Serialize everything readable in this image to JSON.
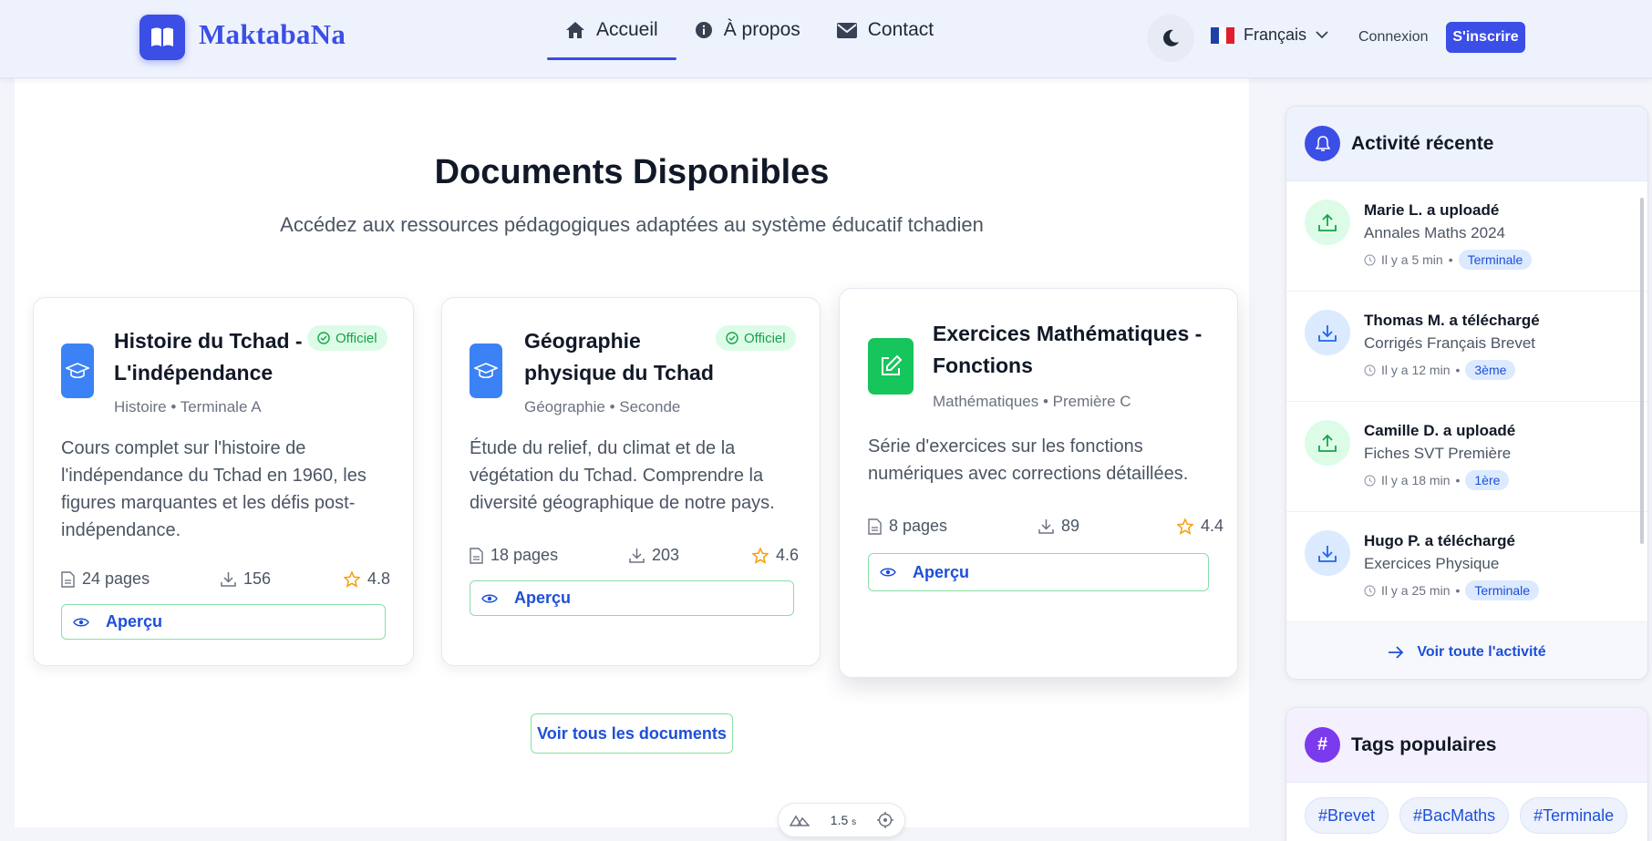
{
  "brand": {
    "name": "MaktabaNa",
    "color": "#3b4ee6"
  },
  "nav": [
    {
      "label": "Accueil",
      "icon": "home-icon",
      "active": true
    },
    {
      "label": "À propos",
      "icon": "info-icon",
      "active": false
    },
    {
      "label": "Contact",
      "icon": "mail-icon",
      "active": false
    }
  ],
  "header": {
    "language": "Français",
    "login": "Connexion",
    "signup": "S'inscrire"
  },
  "section": {
    "title": "Documents Disponibles",
    "subtitle": "Accédez aux ressources pédagogiques adaptées au système éducatif tchadien"
  },
  "documents": [
    {
      "title_line1": "Histoire du Tchad -",
      "title_line2": "L'indépendance",
      "meta": "Histoire • Terminale A",
      "badge": "Officiel",
      "desc": [
        "Cours complet sur l'histoire de",
        "l'indépendance du Tchad en 1960, les",
        "figures marquantes et les défis post-",
        "indépendance."
      ],
      "pages": "24 pages",
      "downloads": "156",
      "rating": "4.8",
      "preview": "Aperçu",
      "icon": "graduation-cap-icon"
    },
    {
      "title_line1": "Géographie",
      "title_line2": "physique du Tchad",
      "meta": "Géographie • Seconde",
      "badge": "Officiel",
      "desc": [
        "Étude du relief, du climat et de la",
        "végétation du Tchad. Comprendre la",
        "diversité géographique de notre pays."
      ],
      "pages": "18 pages",
      "downloads": "203",
      "rating": "4.6",
      "preview": "Aperçu",
      "icon": "graduation-cap-icon"
    },
    {
      "title_line1": "Exercices Mathématiques -",
      "title_line2": "Fonctions",
      "meta": "Mathématiques • Première C",
      "desc": [
        "Série d'exercices sur les fonctions",
        "numériques avec corrections détaillées."
      ],
      "pages": "8 pages",
      "downloads": "89",
      "rating": "4.4",
      "preview": "Aperçu",
      "icon": "edit-icon"
    }
  ],
  "all_documents": "Voir tous les documents",
  "devbar": {
    "time": "1.5",
    "unit": "s"
  },
  "activity": {
    "title": "Activité récente",
    "items": [
      {
        "name": "Marie L. a uploadé",
        "doc": "Annales Maths 2024",
        "time": "Il y a 5 min",
        "level": "Terminale",
        "type": "upload"
      },
      {
        "name": "Thomas M. a téléchargé",
        "doc": "Corrigés Français Brevet",
        "time": "Il y a 12 min",
        "level": "3ème",
        "type": "download"
      },
      {
        "name": "Camille D. a uploadé",
        "doc": "Fiches SVT Première",
        "time": "Il y a 18 min",
        "level": "1ère",
        "type": "upload"
      },
      {
        "name": "Hugo P. a téléchargé",
        "doc": "Exercices Physique",
        "time": "Il y a 25 min",
        "level": "Terminale",
        "type": "download"
      }
    ],
    "footer": "Voir toute l'activité"
  },
  "tags": {
    "title": "Tags populaires",
    "items": [
      "#Brevet",
      "#BacMaths",
      "#Terminale"
    ]
  }
}
